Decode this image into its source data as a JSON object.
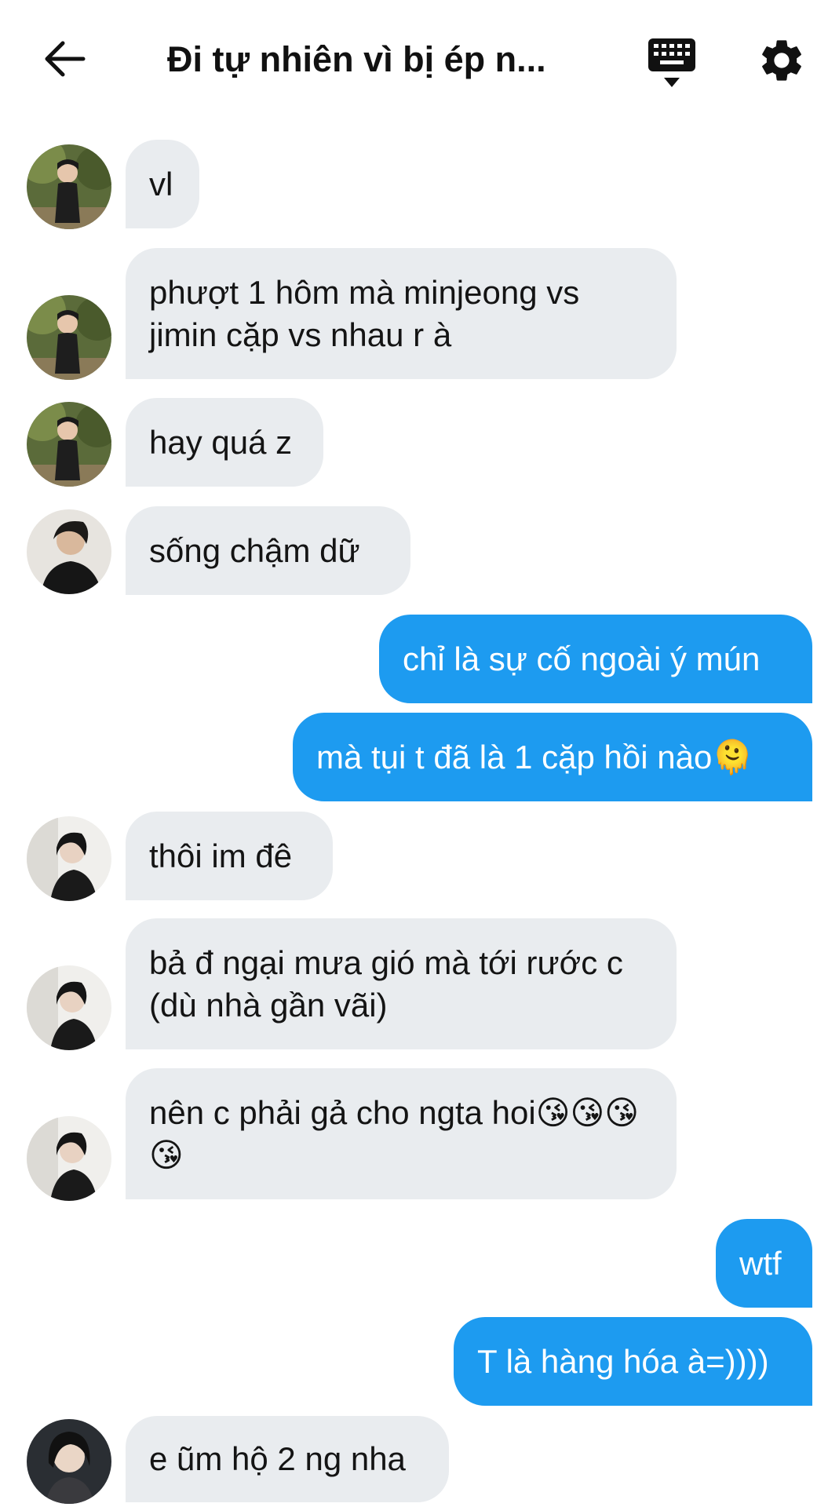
{
  "header": {
    "title": "Đi tự nhiên vì bị ép n..."
  },
  "colors": {
    "incoming_bubble": "#e9ecef",
    "outgoing_bubble": "#1d9bf0",
    "accent": "#1d9bf0"
  },
  "icons": {
    "back": "back-arrow-icon",
    "keyboard": "keyboard-icon",
    "settings": "gear-icon"
  },
  "messages": [
    {
      "direction": "incoming",
      "sender": "user-a",
      "text": "vl"
    },
    {
      "direction": "incoming",
      "sender": "user-a",
      "text": "phượt 1 hôm mà minjeong vs jimin cặp vs nhau r à"
    },
    {
      "direction": "incoming",
      "sender": "user-a",
      "text": "hay quá z"
    },
    {
      "direction": "incoming",
      "sender": "user-b",
      "text": "sống chậm dữ"
    },
    {
      "direction": "outgoing",
      "text": "chỉ là sự cố ngoài ý mún"
    },
    {
      "direction": "outgoing",
      "text": "mà tụi t đã là 1 cặp hồi nào🫠"
    },
    {
      "direction": "incoming",
      "sender": "user-c",
      "text": "thôi im đê"
    },
    {
      "direction": "incoming",
      "sender": "user-c",
      "text": "bả đ ngại mưa gió mà tới rước c (dù nhà gần vãi)"
    },
    {
      "direction": "incoming",
      "sender": "user-c",
      "text": "nên c phải gả cho ngta hoi😘😘😘😘"
    },
    {
      "direction": "outgoing",
      "text": "wtf"
    },
    {
      "direction": "outgoing",
      "text": "T là hàng hóa à=))))"
    },
    {
      "direction": "incoming",
      "sender": "user-d",
      "text": "e ũm hộ 2 ng nha"
    }
  ]
}
